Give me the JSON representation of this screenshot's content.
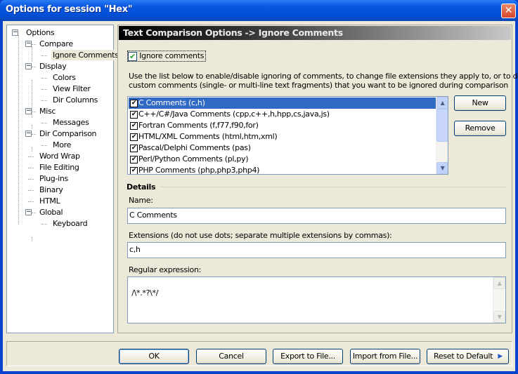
{
  "window": {
    "title": "Options for session \"Hex\"",
    "close_glyph": "✕"
  },
  "tree": {
    "items": [
      {
        "label": "Options",
        "depth": 0,
        "expanded": true
      },
      {
        "label": "Compare",
        "depth": 1,
        "expanded": true
      },
      {
        "label": "Ignore Comments",
        "depth": 2,
        "selected": true
      },
      {
        "label": "Display",
        "depth": 1,
        "expanded": true
      },
      {
        "label": "Colors",
        "depth": 2
      },
      {
        "label": "View Filter",
        "depth": 2
      },
      {
        "label": "Dir Columns",
        "depth": 2
      },
      {
        "label": "Misc",
        "depth": 1,
        "expanded": true
      },
      {
        "label": "Messages",
        "depth": 2
      },
      {
        "label": "Dir Comparison",
        "depth": 1,
        "expanded": true
      },
      {
        "label": "More",
        "depth": 2
      },
      {
        "label": "Word Wrap",
        "depth": 1
      },
      {
        "label": "File Editing",
        "depth": 1
      },
      {
        "label": "Plug-ins",
        "depth": 1
      },
      {
        "label": "Binary",
        "depth": 1
      },
      {
        "label": "HTML",
        "depth": 1
      },
      {
        "label": "Global",
        "depth": 1,
        "expanded": true
      },
      {
        "label": "Keyboard",
        "depth": 2
      }
    ]
  },
  "panel": {
    "header": "Text Comparison Options -> Ignore Comments",
    "ignore_checkbox": {
      "label": "Ignore comments",
      "checked": true
    },
    "description_1": "Use the list below to enable/disable ignoring of comments, to change file extensions they apply to, or to define",
    "description_2": "custom comments (single- or multi-line text fragments) that you want to be ignored during comparison",
    "comments": [
      {
        "label": "C Comments (c,h)",
        "checked": true,
        "selected": true
      },
      {
        "label": "C++/C#/Java Comments (cpp,c++,h,hpp,cs,java,js)",
        "checked": true
      },
      {
        "label": "Fortran Comments (f,f77,f90,for)",
        "checked": true
      },
      {
        "label": "HTML/XML Comments (html,htm,xml)",
        "checked": true
      },
      {
        "label": "Pascal/Delphi Comments (pas)",
        "checked": true
      },
      {
        "label": "Perl/Python Comments (pl,py)",
        "checked": true
      },
      {
        "label": "PHP Comments (php,php3,php4)",
        "checked": true
      }
    ],
    "new_button": "New",
    "remove_button": "Remove",
    "details_label": "Details",
    "name_label": "Name:",
    "name_value": "C Comments",
    "extensions_label": "Extensions (do not use dots; separate multiple extensions by commas):",
    "extensions_value": "c,h",
    "regex_label": "Regular expression:",
    "regex_value": "/\\*.*?\\*/"
  },
  "footer": {
    "ok": "OK",
    "cancel": "Cancel",
    "export": "Export to File...",
    "import": "Import from File...",
    "reset": "Reset to Default"
  },
  "colors": {
    "selection": "#316ac5",
    "titlebar": "#0450d8",
    "face": "#ece9d8"
  }
}
